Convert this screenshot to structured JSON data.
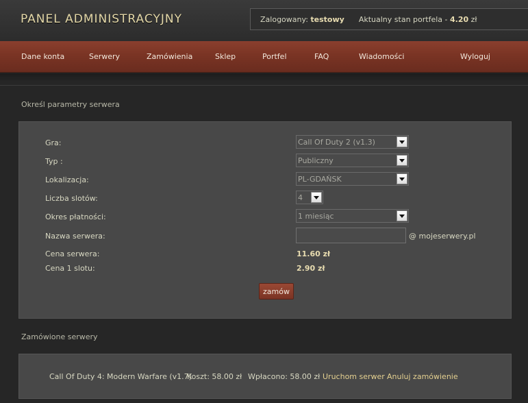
{
  "header": {
    "logo": "PANEL ADMINISTRACYJNY",
    "logged_label": "Zalogowany:",
    "username": "testowy",
    "wallet_label": "Aktualny stan portfela -",
    "wallet_value": "4.20",
    "wallet_currency": "zł"
  },
  "nav": {
    "items": [
      "Dane konta",
      "Serwery",
      "Zamówienia",
      "Sklep",
      "Portfel",
      "FAQ",
      "Wiadomości",
      "Wyloguj"
    ]
  },
  "form": {
    "title": "Określ parametry serwera",
    "labels": {
      "game": "Gra:",
      "type": "Typ :",
      "location": "Lokalizacja:",
      "slots": "Liczba slotów:",
      "period": "Okres płatności:",
      "name": "Nazwa serwera:",
      "server_price": "Cena serwera:",
      "slot_price": "Cena 1 slotu:"
    },
    "values": {
      "game": "Call Of Duty 2 (v1.3)",
      "type": "Publiczny",
      "location": "PL-GDAŃSK",
      "slots": "4",
      "period": "1 miesiąc",
      "name": "",
      "name_suffix": "@ mojeserwery.pl",
      "server_price": "11.60 zł",
      "slot_price": "2.90 zł"
    },
    "order_button": "zamów"
  },
  "orders": {
    "title": "Zamówione serwery",
    "items": [
      {
        "name": "Call Of Duty 4: Modern Warfare (v1.7)",
        "cost": "Koszt: 58.00 zł",
        "paid": "Wpłacono: 58.00 zł",
        "start_link": "Uruchom serwer",
        "cancel_link": "Anuluj zamówienie"
      }
    ]
  },
  "colors": {
    "nav_bg": "#7a3424",
    "accent_text": "#e8dcb0",
    "link": "#e4d090",
    "panel_bg": "#484848",
    "page_bg": "#262626"
  }
}
